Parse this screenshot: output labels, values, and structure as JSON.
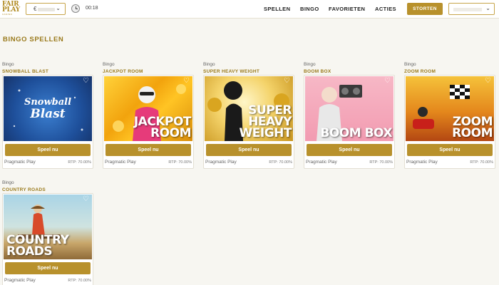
{
  "header": {
    "logo_line1": "FAIR",
    "logo_line2": "PLAY",
    "logo_line3": "CASINO",
    "currency_symbol": "€",
    "clock_time": "00:18",
    "nav": [
      "SPELLEN",
      "BINGO",
      "FAVORIETEN",
      "ACTIES"
    ],
    "deposit_label": "STORTEN"
  },
  "section_title": "BINGO SPELLEN",
  "play_label": "Speel nu",
  "games": [
    {
      "category": "Bingo",
      "name": "SNOWBALL BLAST",
      "thumb_title": "",
      "art_logo": "Snowball Blast",
      "provider": "Pragmatic Play",
      "rtp": "RTP: 70.00%"
    },
    {
      "category": "Bingo",
      "name": "JACKPOT ROOM",
      "thumb_title": "JACKPOT ROOM",
      "provider": "Pragmatic Play",
      "rtp": "RTP: 70.00%"
    },
    {
      "category": "Bingo",
      "name": "SUPER HEAVY WEIGHT",
      "thumb_title": "SUPER HEAVY WEIGHT",
      "provider": "Pragmatic Play",
      "rtp": "RTP: 70.00%"
    },
    {
      "category": "Bingo",
      "name": "BOOM BOX",
      "thumb_title": "BOOM BOX",
      "provider": "Pragmatic Play",
      "rtp": "RTP: 70.00%"
    },
    {
      "category": "Bingo",
      "name": "ZOOM ROOM",
      "thumb_title": "ZOOM ROOM",
      "provider": "Pragmatic Play",
      "rtp": "RTP: 70.00%"
    },
    {
      "category": "Bingo",
      "name": "COUNTRY ROADS",
      "thumb_title": "COUNTRY ROADS",
      "provider": "Pragmatic Play",
      "rtp": "RTP: 70.00%"
    }
  ],
  "colors": {
    "accent": "#b8912c",
    "title_gold": "#9a7a1c",
    "background": "#f7f6f1"
  }
}
